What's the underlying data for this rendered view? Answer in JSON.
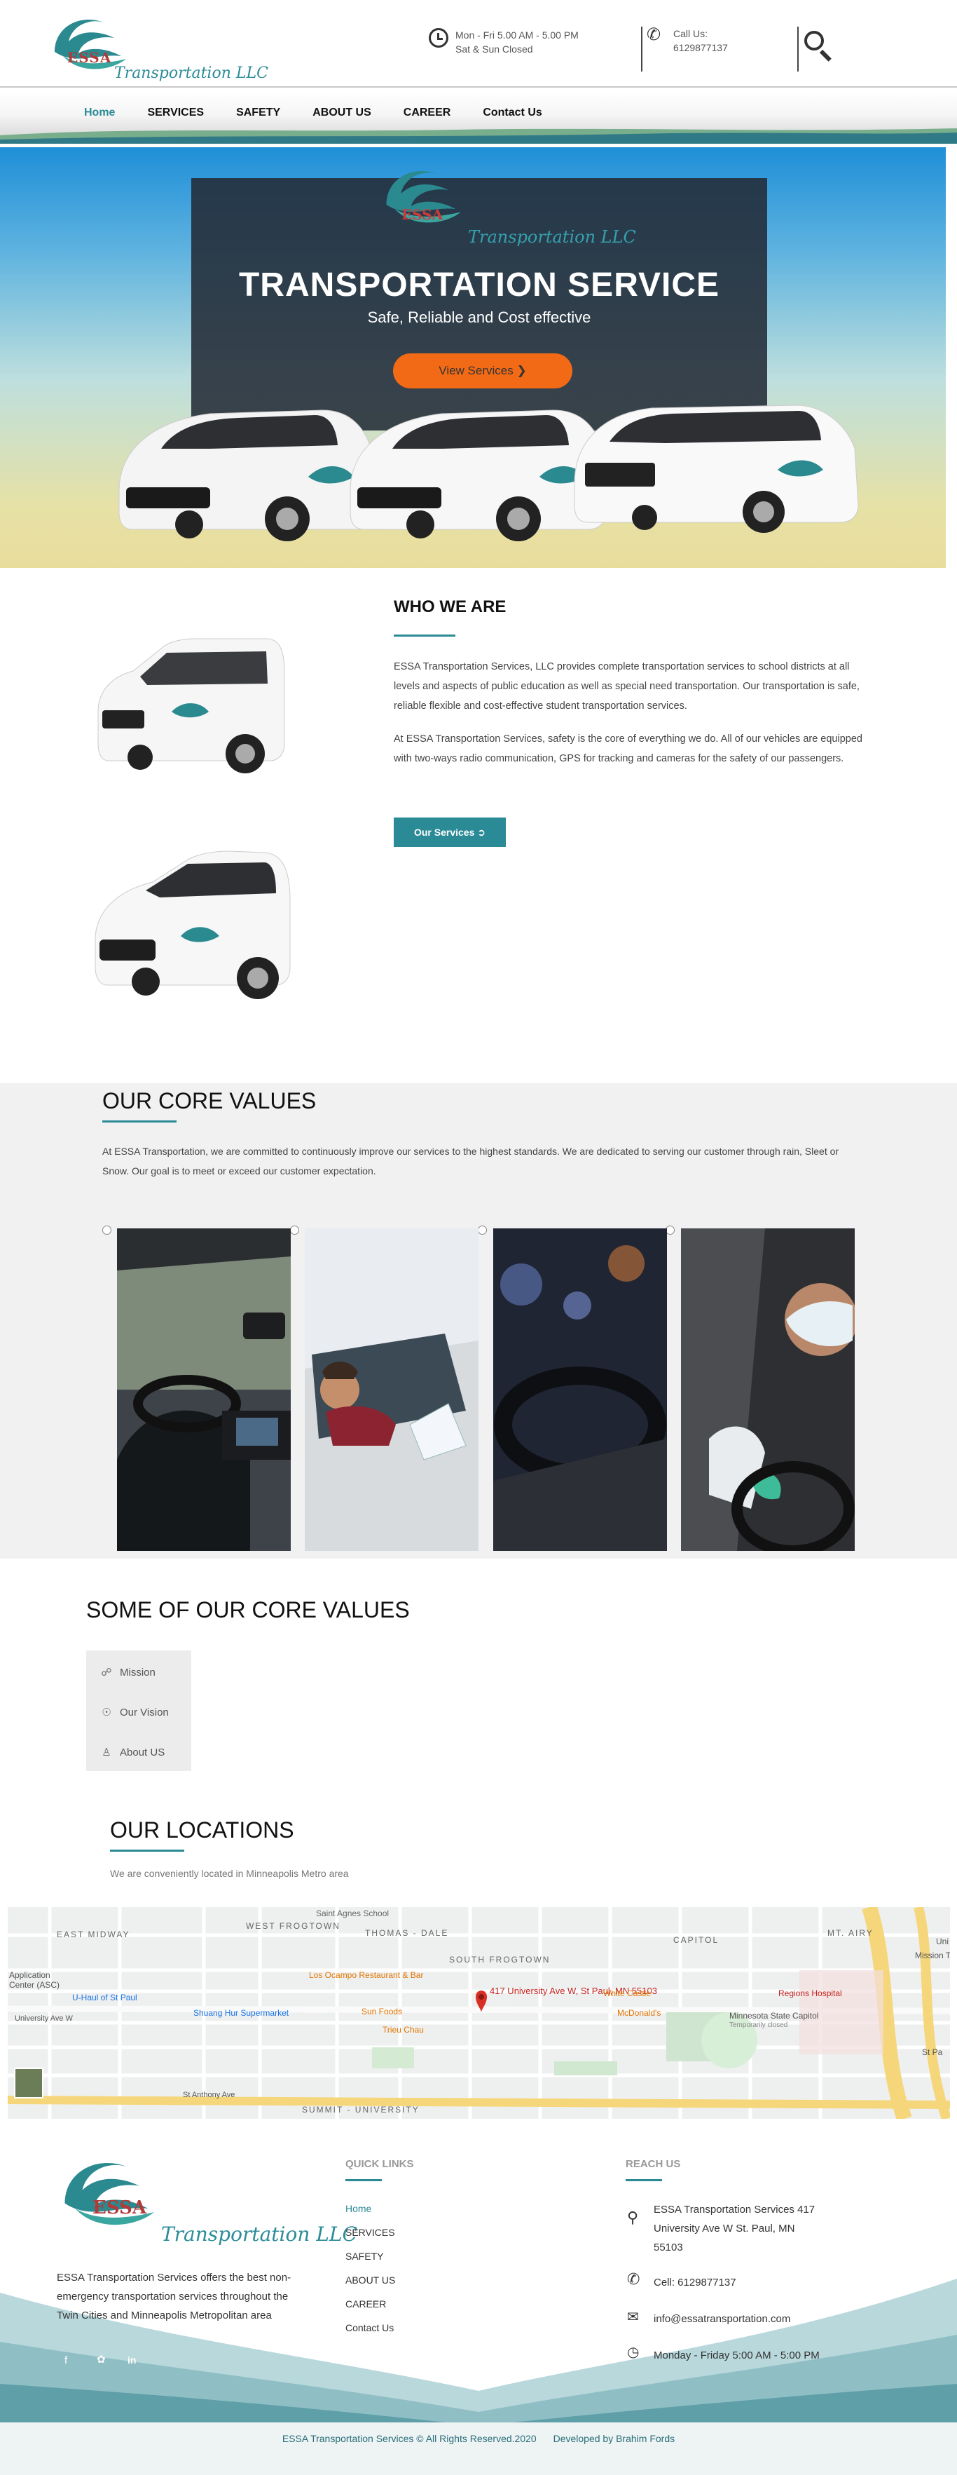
{
  "header": {
    "logo_brand": "ESSA",
    "logo_tagline": "Transportation LLC",
    "hours_line1": "Mon - Fri 5.00 AM - 5.00 PM",
    "hours_line2": "Sat & Sun Closed",
    "call_label": "Call Us:",
    "call_number": "6129877137"
  },
  "nav": {
    "items": [
      "Home",
      "SERVICES",
      "SAFETY",
      "ABOUT US",
      "CAREER",
      "Contact Us"
    ],
    "active": "Home"
  },
  "hero": {
    "logo_brand": "ESSA",
    "logo_tagline": "Transportation LLC",
    "title": "TRANSPORTATION SERVICE",
    "subtitle": "Safe, Reliable and Cost effective",
    "button": "View Services"
  },
  "who": {
    "title": "WHO WE ARE",
    "p1": "ESSA Transportation Services, LLC provides complete transportation services to school districts at all levels and aspects of public education as well as special need transportation. Our transportation is safe, reliable flexible and cost-effective student transportation services.",
    "p2": "At ESSA Transportation Services, safety is the core of everything we do. All of our vehicles are equipped with two-ways radio communication, GPS for tracking and cameras for the safety of our passengers.",
    "button": "Our Services"
  },
  "core": {
    "title": "OUR CORE VALUES",
    "text": "At ESSA Transportation, we are committed to continuously improve our services to the highest standards. We are dedicated to serving our customer through rain, Sleet or Snow. Our goal is to meet or exceed our customer expectation."
  },
  "some": {
    "title": "SOME OF OUR CORE VALUES",
    "tabs": [
      "Mission",
      "Our Vision",
      "About US"
    ]
  },
  "locations": {
    "title": "OUR LOCATIONS",
    "subtitle": "We are conveniently located in Minneapolis Metro area",
    "map_labels": {
      "east_midway": "EAST MIDWAY",
      "west_frogtown": "WEST FROGTOWN",
      "thomas_dale": "THOMAS - DALE",
      "south_frogtown": "SOUTH FROGTOWN",
      "capitol": "CAPITOL",
      "mt_airy": "MT. AIRY",
      "summit_university": "SUMMIT - UNIVERSITY",
      "pin": "417 University Ave W, St Paul, MN 55103",
      "uhaul": "U-Haul of St Paul",
      "shuang_hur": "Shuang Hur Supermarket",
      "los_ocampo": "Los Ocampo Restaurant & Bar",
      "sun_foods": "Sun Foods",
      "trieu_chau": "Trieu Chau",
      "white_castle": "White Castle",
      "mcdonalds": "McDonald's",
      "regions_hospital": "Regions Hospital",
      "capitol_bldg": "Minnesota State Capitol",
      "capitol_note": "Temporarily closed",
      "saint_agnes": "Saint Agnes School",
      "univ_ave": "University Ave W",
      "st_anthony": "St Anthony Ave",
      "application": "Application Center (ASC)",
      "st_pa": "St Pa",
      "mission_te": "Mission Te",
      "uni": "Uni"
    }
  },
  "footer": {
    "logo_brand": "ESSA",
    "logo_tagline": "Transportation LLC",
    "about": "ESSA Transportation Services offers the best non-emergency transportation services throughout the Twin Cities and Minneapolis Metropolitan area",
    "quick_links_title": "QUICK LINKS",
    "quick_links": [
      "Home",
      "SERVICES",
      "SAFETY",
      "ABOUT US",
      "CAREER",
      "Contact Us"
    ],
    "reach_title": "REACH US",
    "address": "ESSA Transportation Services 417 University Ave W St. Paul, MN 55103",
    "cell": "Cell: 6129877137",
    "email": "info@essatransportation.com",
    "hours": "Monday - Friday 5:00 AM - 5:00 PM",
    "copyright": "ESSA Transportation Services © All Rights Reserved.2020",
    "developed": "Developed by Brahim Fords"
  }
}
